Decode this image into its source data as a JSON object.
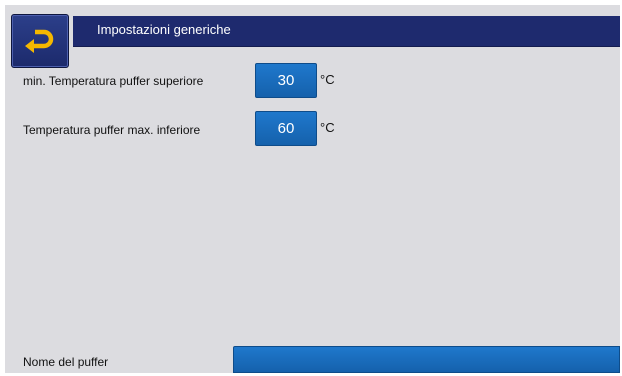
{
  "header": {
    "title": "Impostazioni generiche",
    "back_icon": "return-arrow-icon"
  },
  "parameters": [
    {
      "label": "min. Temperatura puffer superiore",
      "value": "30",
      "unit": "°C"
    },
    {
      "label": "Temperatura puffer max. inferiore",
      "value": "60",
      "unit": "°C"
    }
  ],
  "buffer_name": {
    "label": "Nome del puffer",
    "value": ""
  },
  "colors": {
    "title_bar": "#1e2a6e",
    "value_box": "#1a6cbf",
    "background": "#dcdce0",
    "icon_arrow": "#f5b800"
  }
}
